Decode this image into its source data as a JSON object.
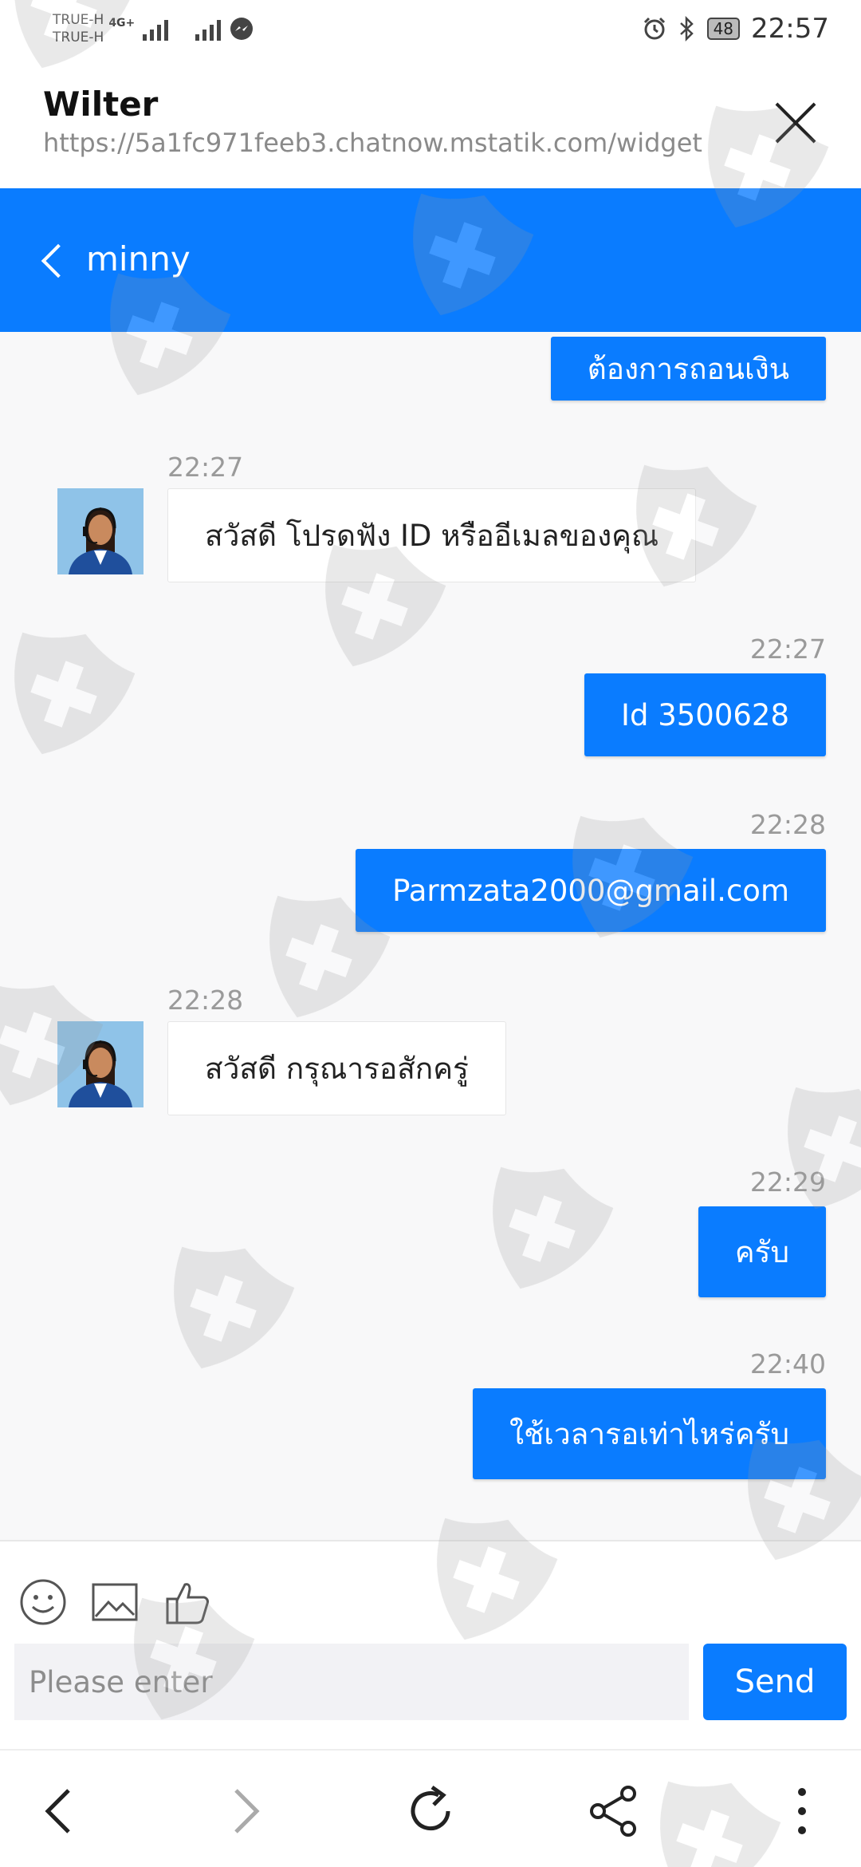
{
  "status_bar": {
    "carrier_1": "TRUE-H",
    "carrier_2": "TRUE-H",
    "network": "4G+",
    "battery": "48",
    "time": "22:57"
  },
  "browser": {
    "title": "Wilter",
    "url": "https://5a1fc971feeb3.chatnow.mstatik.com/widget"
  },
  "chat": {
    "agent_name": "minny",
    "messages": [
      {
        "side": "right",
        "time": "",
        "text": "ต้องการถอนเงิน"
      },
      {
        "side": "left",
        "time": "22:27",
        "text": "สวัสดี โปรดฟัง ID หรืออีเมลของคุณ"
      },
      {
        "side": "right",
        "time": "22:27",
        "text": "Id 3500628"
      },
      {
        "side": "right",
        "time": "22:28",
        "text": "Parmzata2000@gmail.com"
      },
      {
        "side": "left",
        "time": "22:28",
        "text": "สวัสดี กรุณารอสักครู่"
      },
      {
        "side": "right",
        "time": "22:29",
        "text": "ครับ"
      },
      {
        "side": "right",
        "time": "22:40",
        "text": "ใช้เวลารอเท่าไหร่ครับ"
      }
    ]
  },
  "composer": {
    "placeholder": "Please enter",
    "send_label": "Send"
  },
  "icons": {
    "emoji": "emoji-icon",
    "image": "image-icon",
    "like": "thumbs-up-icon",
    "back": "chevron-left-icon",
    "forward": "chevron-right-icon",
    "refresh": "refresh-icon",
    "share": "share-icon",
    "more": "more-vertical-icon"
  },
  "colors": {
    "accent": "#0a7cff",
    "chat_bg": "#f8f8f9"
  }
}
